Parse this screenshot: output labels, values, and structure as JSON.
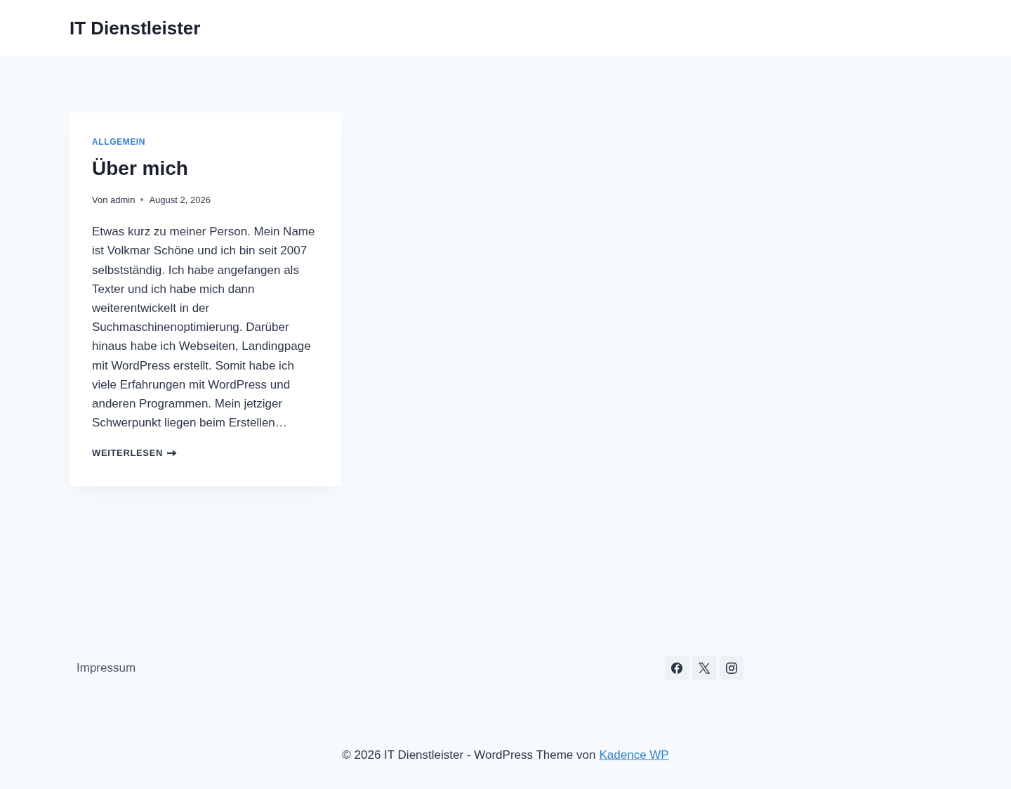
{
  "header": {
    "site_title": "IT Dienstleister"
  },
  "post": {
    "category": "ALLGEMEIN",
    "title": "Über mich",
    "author_prefix": "Von",
    "author": "admin",
    "date": "August 2, 2026",
    "excerpt": "Etwas kurz zu meiner Person. Mein Name ist Volkmar Schöne und ich bin seit 2007 selbstständig. Ich habe angefangen als Texter und ich habe mich dann weiterentwickelt in der Suchmaschinenoptimierung. Darüber hinaus habe ich Webseiten, Landingpage mit WordPress erstellt. Somit habe ich viele Erfahrungen mit WordPress und anderen Programmen. Mein jetziger Schwerpunkt liegen beim Erstellen…",
    "read_more": "WEITERLESEN"
  },
  "footer": {
    "links": [
      "Impressum"
    ],
    "social": [
      {
        "kind": "facebook"
      },
      {
        "kind": "x"
      },
      {
        "kind": "instagram"
      }
    ],
    "copyright": "© 2026 IT Dienstleister - WordPress Theme von",
    "credit_link": "Kadence WP"
  }
}
